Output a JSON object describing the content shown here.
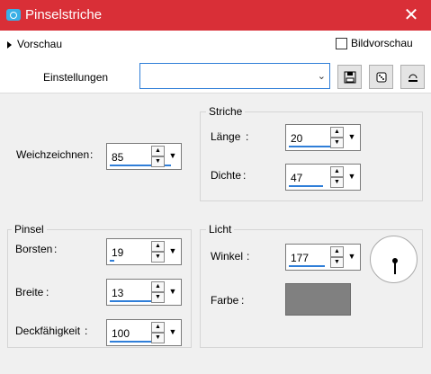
{
  "window": {
    "title": "Pinselstriche",
    "close_icon": "close-icon",
    "app_icon": "camera-icon"
  },
  "top": {
    "preview_label": "Vorschau",
    "image_preview_label": "Bildvorschau",
    "image_preview_checked": false,
    "settings_label": "Einstellungen",
    "settings_value": "",
    "buttons": [
      "save-icon",
      "randomize-dice-icon",
      "reset-icon"
    ]
  },
  "left_top": {
    "soften_label": "Weichzeichnen",
    "soften_value": "85"
  },
  "strokes": {
    "title": "Striche",
    "length_label": "Länge",
    "length_value": "20",
    "density_label": "Dichte",
    "density_value": "47"
  },
  "brush": {
    "title": "Pinsel",
    "bristles_label": "Borsten",
    "bristles_value": "19",
    "width_label": "Breite",
    "width_value": "13",
    "opacity_label": "Deckfähigkeit",
    "opacity_value": "100"
  },
  "light": {
    "title": "Licht",
    "angle_label": "Winkel",
    "angle_value": "177",
    "color_label": "Farbe",
    "color": "#808080"
  },
  "colors": {
    "title_bar": "#d92f37",
    "accent": "#2f7ed8"
  }
}
